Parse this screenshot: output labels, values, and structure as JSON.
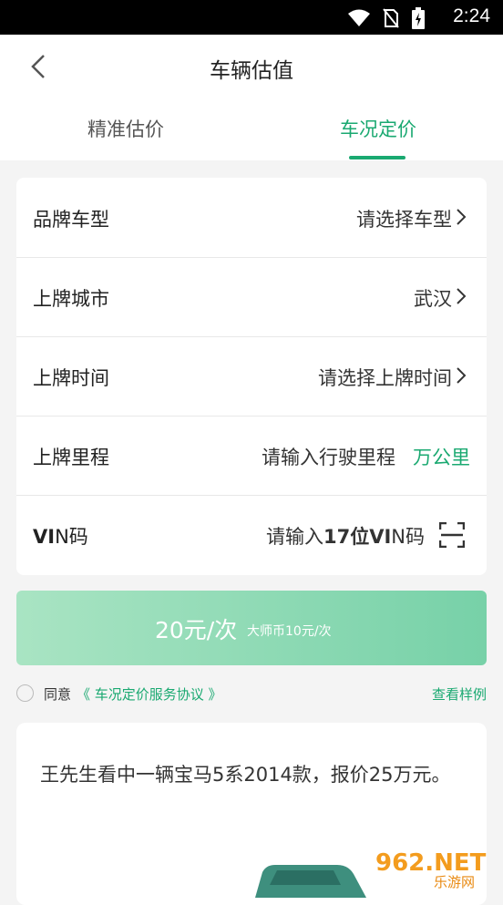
{
  "status_bar": {
    "time": "2:24"
  },
  "header": {
    "title": "车辆估值"
  },
  "tabs": [
    {
      "label": "精准估价"
    },
    {
      "label": "车况定价"
    }
  ],
  "form": {
    "brand_model": {
      "label": "品牌车型",
      "value": "请选择车型"
    },
    "city": {
      "label": "上牌城市",
      "value": "武汉"
    },
    "reg_time": {
      "label": "上牌时间",
      "value": "请选择上牌时间"
    },
    "mileage": {
      "label": "上牌里程",
      "placeholder": "请输入行驶里程",
      "unit": "万公里"
    },
    "vin": {
      "label_a": "VI",
      "label_b": "N码",
      "placeholder_a": "请输入",
      "placeholder_b": "17位VI",
      "placeholder_c": "N码"
    }
  },
  "price_button": {
    "main": "20元/次",
    "sub": "大师币10元/次"
  },
  "agreement": {
    "text": "同意",
    "link": "《 车况定价服务协议 》",
    "sample": "查看样例"
  },
  "card": {
    "text": "王先生看中一辆宝马5系2014款，报价25万元。"
  },
  "watermark": {
    "brand": "962.NET",
    "sub": "乐游网"
  },
  "colors": {
    "accent": "#1aa971"
  }
}
